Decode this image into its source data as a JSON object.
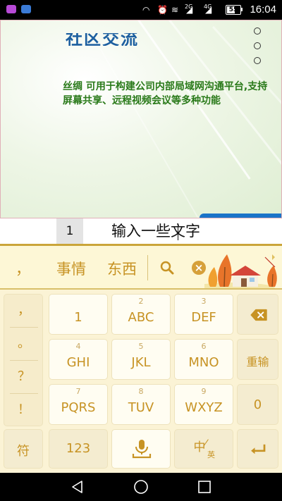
{
  "status_bar": {
    "time": "16:04",
    "battery": "55",
    "battery_level_percent": 55,
    "net_2g": "2G",
    "net_4g": "4G",
    "app_icon_colors": [
      "#b84ad6",
      "#3b7bd6"
    ]
  },
  "slide": {
    "description": "丝绸 可用于构建公司内部局域网沟通平台,支持屏幕共享、远程视频会议等多种功能",
    "title_fragment": "社区交流",
    "accent_color": "#1a73c8"
  },
  "input": {
    "page_number": "1",
    "typed_text": "输入一些文字"
  },
  "candidates": {
    "items": [
      "，",
      "事情",
      "东西"
    ],
    "search_icon": "search-icon",
    "clear_icon": "clear-icon"
  },
  "keyboard": {
    "punct": [
      "，",
      "。",
      "？",
      "！"
    ],
    "keys": [
      {
        "sub": "",
        "main": "1"
      },
      {
        "sub": "2",
        "main": "ABC"
      },
      {
        "sub": "3",
        "main": "DEF"
      },
      {
        "sub": "4",
        "main": "GHI"
      },
      {
        "sub": "5",
        "main": "JKL"
      },
      {
        "sub": "6",
        "main": "MNO"
      },
      {
        "sub": "7",
        "main": "PQRS"
      },
      {
        "sub": "8",
        "main": "TUV"
      },
      {
        "sub": "9",
        "main": "WXYZ"
      }
    ],
    "reinput": "重输",
    "zero": "0",
    "symbol": "符",
    "num": "123",
    "lang_main": "中",
    "lang_sub": "英",
    "text_color": "#c79324"
  }
}
